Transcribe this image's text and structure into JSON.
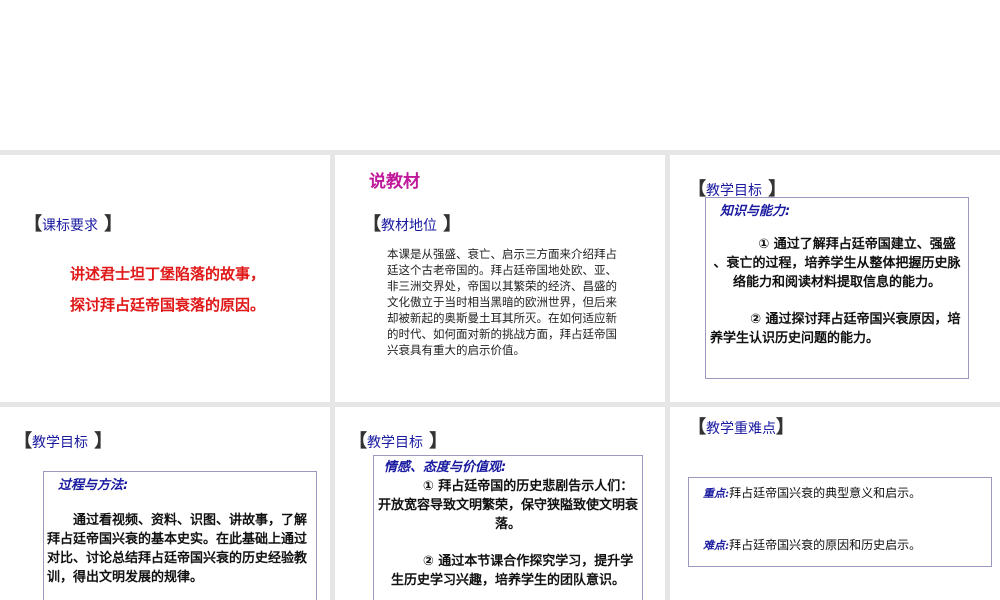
{
  "slides": [
    {
      "heading": "课标要求",
      "lines": [
        "讲述君士坦丁堡陷落的故事，",
        "探讨拜占廷帝国衰落的原因。"
      ]
    },
    {
      "title": "说教材",
      "heading": "教材地位",
      "body": "本课是从强盛、衰亡、启示三方面来介绍拜占廷这个古老帝国的。拜占廷帝国地处欧、亚、非三洲交界处，帝国以其繁荣的经济、昌盛的文化傲立于当时相当黑暗的欧洲世界，但后来却被新起的奥斯曼土耳其所灭。在如何适应新的时代、如何面对新的挑战方面，拜占廷帝国兴衰具有重大的启示价值。"
    },
    {
      "heading": "教学目标",
      "subtitle": "知识与能力:",
      "p1": "① 通过了解拜占廷帝国建立、强盛 、衰亡的过程，培养学生从整体把握历史脉络能力和阅读材料提取信息的能力。",
      "p2": "② 通过探讨拜占廷帝国兴衰原因，培养学生认识历史问题的能力。"
    },
    {
      "heading": "教学目标",
      "subtitle": "过程与方法:",
      "p1": "通过看视频、资料、识图、讲故事，了解拜占廷帝国兴衰的基本史实。在此基础上通过对比、讨论总结拜占廷帝国兴衰的历史经验教训，得出文明发展的规律。"
    },
    {
      "heading": "教学目标",
      "subtitle": "情感、态度与价值观:",
      "p1": "① 拜占廷帝国的历史悲剧告示人们：开放宽容导致文明繁荣，保守狭隘致使文明衰落。",
      "p2": "② 通过本节课合作探究学习，提升学生历史学习兴趣，培养学生的团队意识。"
    },
    {
      "heading": "教学重难点",
      "key_label": "重点:",
      "key_text": "拜占廷帝国兴衰的典型意义和启示。",
      "diff_label": "难点:",
      "diff_text": "拜占廷帝国兴衰的原因和历史启示。"
    }
  ]
}
